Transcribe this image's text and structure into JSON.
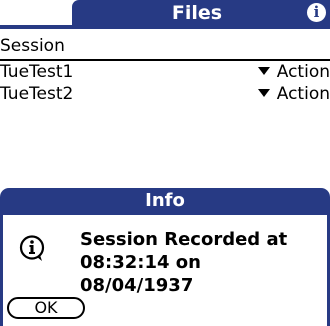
{
  "app": {
    "title": "Files",
    "info_icon": "info-icon"
  },
  "list": {
    "header": "Session",
    "rows": [
      {
        "name": "TueTest1",
        "action": "Action"
      },
      {
        "name": "TueTest2",
        "action": "Action"
      }
    ]
  },
  "dialog": {
    "title": "Info",
    "icon": "info-icon",
    "message_line1": "Session Recorded at",
    "message_line2": "08:32:14 on 08/04/1937",
    "ok_label": "OK"
  },
  "colors": {
    "title_bar": "#273a84",
    "background": "#ffffff",
    "text": "#000000"
  }
}
